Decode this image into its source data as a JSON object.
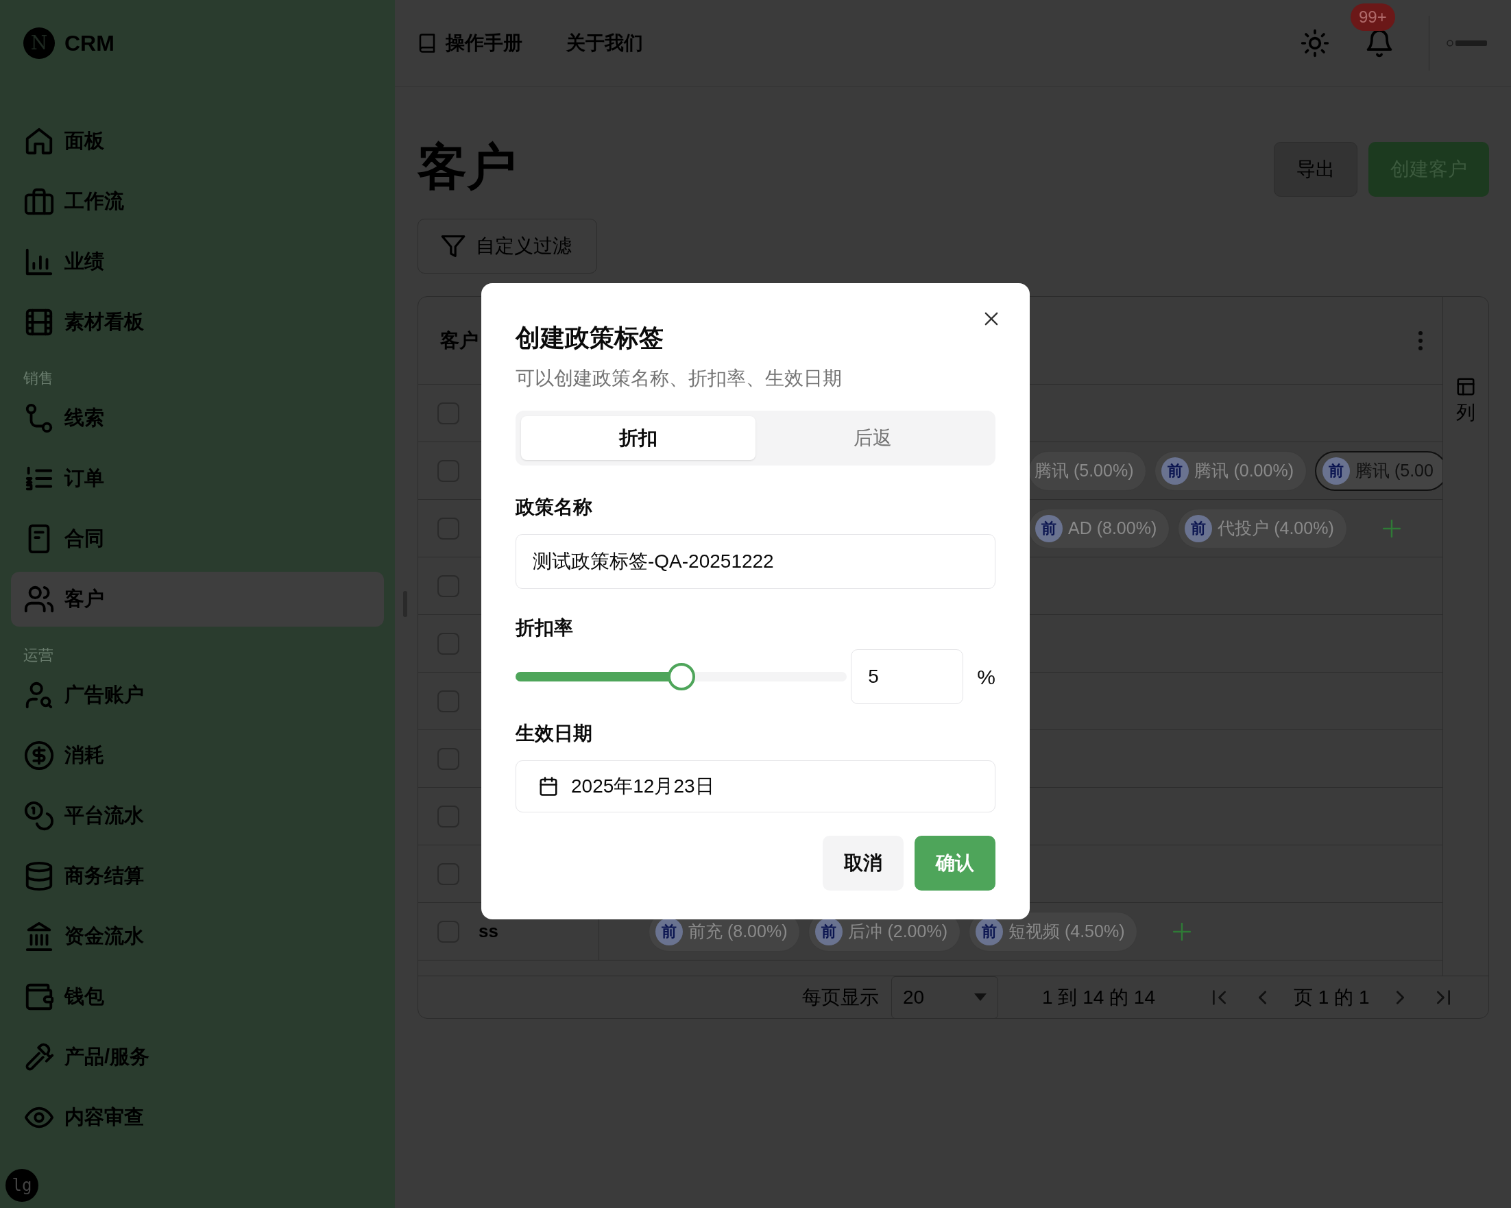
{
  "sidebar": {
    "logo": "N",
    "brand": "CRM",
    "sections": [
      {
        "items": [
          {
            "label": "面板",
            "selected": false
          },
          {
            "label": "工作流",
            "selected": false
          },
          {
            "label": "业绩",
            "selected": false
          },
          {
            "label": "素材看板",
            "selected": false
          }
        ]
      },
      {
        "title": "销售",
        "items": [
          {
            "label": "线索",
            "selected": false
          },
          {
            "label": "订单",
            "selected": false
          },
          {
            "label": "合同",
            "selected": false
          },
          {
            "label": "客户",
            "selected": true
          }
        ]
      },
      {
        "title": "运营",
        "items": [
          {
            "label": "广告账户",
            "selected": false
          },
          {
            "label": "消耗",
            "selected": false
          },
          {
            "label": "平台流水",
            "selected": false
          },
          {
            "label": "商务结算",
            "selected": false
          },
          {
            "label": "资金流水",
            "selected": false
          },
          {
            "label": "钱包",
            "selected": false
          },
          {
            "label": "产品/服务",
            "selected": false
          },
          {
            "label": "内容审查",
            "selected": false
          }
        ]
      }
    ],
    "avatar": "lg"
  },
  "header": {
    "links": [
      {
        "label": "操作手册"
      },
      {
        "label": "关于我们"
      }
    ],
    "notification_badge": "99+"
  },
  "page": {
    "title": "客户",
    "buttons": [
      {
        "label": "导出",
        "kind": "outline"
      },
      {
        "label": "创建客户",
        "kind": "primary"
      }
    ],
    "filter_button": "自定义过滤"
  },
  "table": {
    "column_1": "客户",
    "column_panel": "列",
    "rows": [
      {
        "name": "",
        "checked": false,
        "tags": []
      },
      {
        "name": "",
        "checked": false,
        "tags": [
          {
            "label": "腾讯 (5.00%)",
            "outlined": false
          },
          {
            "badge": "前",
            "label": "腾讯 (0.00%)",
            "outlined": false
          },
          {
            "badge": "前",
            "label": "腾讯 (5.00",
            "outlined": true
          }
        ],
        "add": false
      },
      {
        "name": "",
        "checked": false,
        "tags": [
          {
            "badge": "前",
            "label": "AD (8.00%)",
            "outlined": false
          },
          {
            "badge": "前",
            "label": "代投户 (4.00%)",
            "outlined": false
          }
        ],
        "add": true
      },
      {
        "name": "",
        "checked": false,
        "tags": []
      },
      {
        "name": "",
        "checked": false,
        "tags": []
      },
      {
        "name": "",
        "checked": false,
        "tags": []
      },
      {
        "name": "",
        "checked": false,
        "tags": []
      },
      {
        "name": "",
        "checked": false,
        "tags": []
      },
      {
        "name": "",
        "checked": false,
        "tags": []
      },
      {
        "name": "ss",
        "checked": false,
        "tags": [
          {
            "badge": "前",
            "label": "前充 (8.00%)",
            "outlined": false
          },
          {
            "badge": "前",
            "label": "后冲 (2.00%)",
            "outlined": false
          },
          {
            "badge": "前",
            "label": "短视频 (4.50%)",
            "outlined": false
          }
        ],
        "add": true
      }
    ],
    "footer": {
      "per_page_label": "每页显示",
      "per_page": "20",
      "range": "1 到 14 的 14",
      "page": "页 1 的 1"
    }
  },
  "dialog": {
    "title": "创建政策标签",
    "subtitle": "可以创建政策名称、折扣率、生效日期",
    "tabs": [
      {
        "label": "折扣",
        "selected": true
      },
      {
        "label": "后返",
        "selected": false
      }
    ],
    "name_label": "政策名称",
    "name_value": "测试政策标签-QA-20251222",
    "rate_label": "折扣率",
    "rate": {
      "level": 0.5,
      "value": "5",
      "unit": "%"
    },
    "date_label": "生效日期",
    "date_value": "2025年12月23日",
    "buttons": [
      {
        "label": "取消",
        "kind": "secondary"
      },
      {
        "label": "确认",
        "kind": "primary"
      }
    ]
  }
}
